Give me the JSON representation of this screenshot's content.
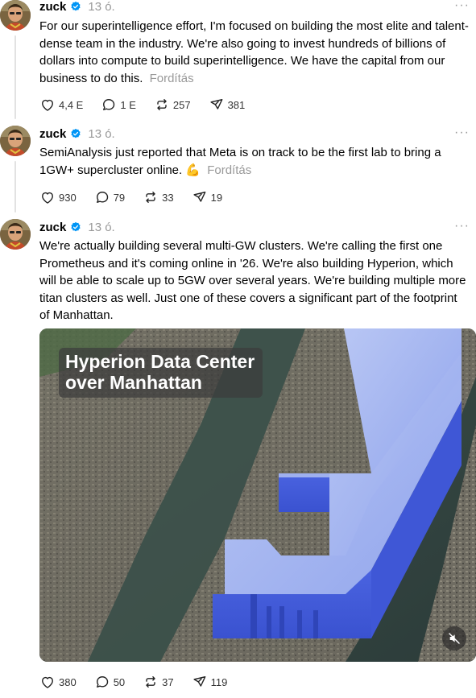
{
  "posts": [
    {
      "username": "zuck",
      "time": "13 ó.",
      "text": "For our superintelligence effort, I'm focused on building the most elite and talent-dense team in the industry. We're also going to invest hundreds of billions of dollars into compute to build superintelligence. We have the capital from our business to do this.",
      "translate": "Fordítás",
      "emoji": "",
      "stats": {
        "likes": "4,4 E",
        "replies": "1 E",
        "reposts": "257",
        "shares": "381"
      }
    },
    {
      "username": "zuck",
      "time": "13 ó.",
      "text": "SemiAnalysis just reported that Meta is on track to be the first lab to bring a 1GW+ supercluster online.",
      "translate": "Fordítás",
      "emoji": "💪",
      "stats": {
        "likes": "930",
        "replies": "79",
        "reposts": "33",
        "shares": "19"
      }
    },
    {
      "username": "zuck",
      "time": "13 ó.",
      "text": "We're actually building several multi-GW clusters. We're calling the first one Prometheus and it's coming online in '26. We're also building Hyperion, which will be able to scale up to 5GW over several years. We're building multiple more titan clusters as well. Just one of these covers a significant part of the footprint of Manhattan.",
      "translate": "",
      "emoji": "",
      "media": {
        "overlay_title_line1": "Hyperion Data Center",
        "overlay_title_line2": "over Manhattan"
      },
      "stats": {
        "likes": "380",
        "replies": "50",
        "reposts": "37",
        "shares": "119"
      }
    }
  ],
  "more_glyph": "···",
  "colors": {
    "verified": "#0095f6",
    "muted_text": "#999999",
    "hyperion_blue": "#5b77e8"
  }
}
